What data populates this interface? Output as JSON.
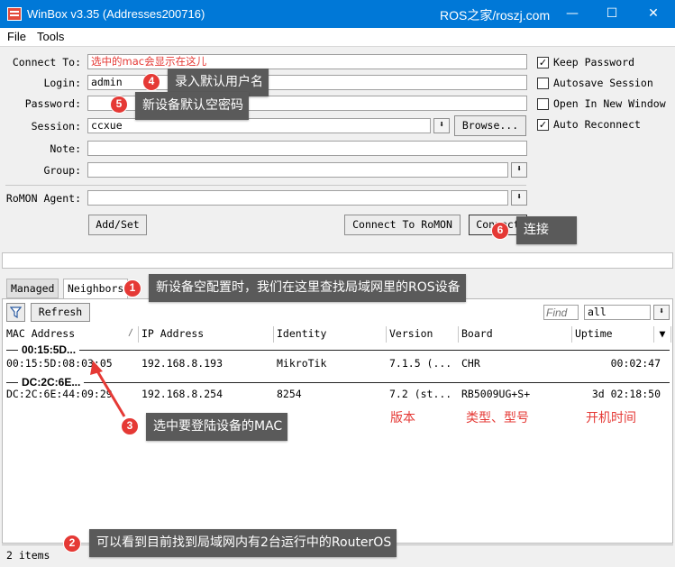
{
  "window": {
    "title": "WinBox v3.35 (Addresses200716)",
    "watermark": "ROS之家/roszj.com",
    "minimize_icon": "minimize-icon",
    "maximize_icon": "maximize-icon",
    "close_icon": "close-icon",
    "accent": "#0078d7"
  },
  "menu": {
    "file": "File",
    "tools": "Tools"
  },
  "form": {
    "connect_to": {
      "label": "Connect To:",
      "value": "选中的mac会显示在这儿"
    },
    "login": {
      "label": "Login:",
      "value": "admin"
    },
    "password": {
      "label": "Password:",
      "value": ""
    },
    "session": {
      "label": "Session:",
      "value": "ccxue",
      "browse": "Browse..."
    },
    "note": {
      "label": "Note:",
      "value": ""
    },
    "group": {
      "label": "Group:",
      "value": ""
    },
    "romon_agent": {
      "label": "RoMON Agent:",
      "value": ""
    },
    "add_set": "Add/Set",
    "connect_romon": "Connect To RoMON",
    "connect": "Connect"
  },
  "options": {
    "keep_password": {
      "label": "Keep Password",
      "checked": true
    },
    "autosave_session": {
      "label": "Autosave Session",
      "checked": false
    },
    "open_new_window": {
      "label": "Open In New Window",
      "checked": false
    },
    "auto_reconnect": {
      "label": "Auto Reconnect",
      "checked": true
    }
  },
  "tabs": {
    "managed": "Managed",
    "neighbors": "Neighbors"
  },
  "toolbar": {
    "refresh": "Refresh",
    "find_placeholder": "Find",
    "filter_value": "all"
  },
  "table": {
    "columns": [
      "MAC Address",
      "IP Address",
      "Identity",
      "Version",
      "Board",
      "Uptime"
    ],
    "groups": [
      {
        "title": "00:15:5D...",
        "row": [
          "00:15:5D:08:03:05",
          "192.168.8.193",
          "MikroTik",
          "7.1.5 (...",
          "CHR",
          "00:02:47"
        ]
      },
      {
        "title": "DC:2C:6E...",
        "row": [
          "DC:2C:6E:44:09:29",
          "192.168.8.254",
          "8254",
          "7.2 (st...",
          "RB5009UG+S+",
          "3d 02:18:50"
        ]
      }
    ]
  },
  "status": {
    "items": "2 items"
  },
  "annotations": {
    "c1": {
      "num": "1",
      "text": "新设备空配置时，我们在这里查找局域网里的ROS设备"
    },
    "c2": {
      "num": "2",
      "text": "可以看到目前找到局域网内有2台运行中的RouterOS"
    },
    "c3": {
      "num": "3",
      "text": "选中要登陆设备的MAC"
    },
    "c4": {
      "num": "4",
      "text": "录入默认用户名"
    },
    "c5": {
      "num": "5",
      "text": "新设备默认空密码"
    },
    "c6": {
      "num": "6",
      "text": "连接"
    },
    "version": "版本",
    "board": "类型、型号",
    "uptime": "开机时间",
    "color": "#e53935"
  }
}
